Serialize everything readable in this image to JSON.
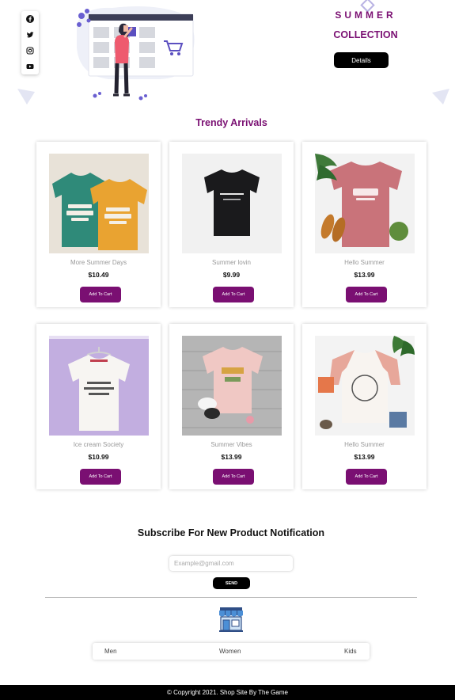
{
  "hero": {
    "title_line1": "SUMMER",
    "title_line2": "COLLECTION",
    "details_label": "Details",
    "social_icons": [
      "facebook-icon",
      "twitter-icon",
      "instagram-icon",
      "youtube-icon"
    ]
  },
  "products": {
    "section_title": "Trendy Arrivals",
    "add_to_cart_label": "Add To Cart",
    "items": [
      {
        "name": "More Summer Days",
        "price": "$10.49"
      },
      {
        "name": "Summer lovin",
        "price": "$9.99"
      },
      {
        "name": "Hello Summer",
        "price": "$13.99"
      },
      {
        "name": "Ice cream Society",
        "price": "$10.99"
      },
      {
        "name": "Summer Vibes",
        "price": "$13.99"
      },
      {
        "name": "Hello Summer",
        "price": "$13.99"
      }
    ]
  },
  "subscribe": {
    "title": "Subscribe For New Product Notification",
    "placeholder": "Example@gmail.com",
    "send_label": "SEND"
  },
  "categories": [
    "Men",
    "Women",
    "Kids"
  ],
  "footer": {
    "copyright": "© Copyright 2021. Shop Site By The Game"
  },
  "colors": {
    "accent": "#7a0f72",
    "dark": "#000000"
  }
}
